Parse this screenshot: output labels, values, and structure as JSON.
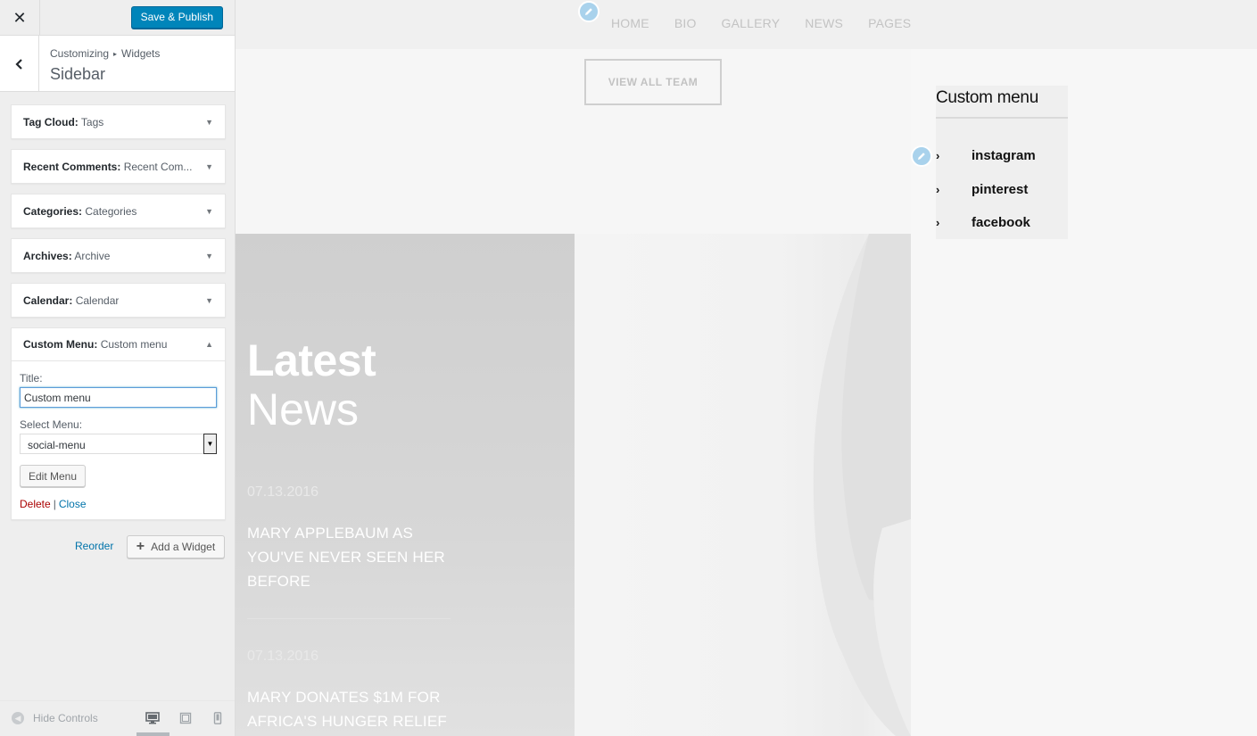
{
  "customizer": {
    "save_label": "Save & Publish",
    "breadcrumb": {
      "parent": "Customizing",
      "child": "Widgets"
    },
    "section_title": "Sidebar",
    "widgets": [
      {
        "type": "Tag Cloud",
        "title": "Tags"
      },
      {
        "type": "Recent Comments",
        "title": "Recent Com..."
      },
      {
        "type": "Categories",
        "title": "Categories"
      },
      {
        "type": "Archives",
        "title": "Archive"
      },
      {
        "type": "Calendar",
        "title": "Calendar"
      },
      {
        "type": "Custom Menu",
        "title": "Custom menu"
      }
    ],
    "custom_menu_form": {
      "title_label": "Title:",
      "title_value": "Custom menu",
      "select_label": "Select Menu:",
      "select_value": "social-menu",
      "edit_menu_label": "Edit Menu",
      "delete_label": "Delete",
      "separator": "|",
      "close_label": "Close"
    },
    "reorder_label": "Reorder",
    "add_widget_label": "Add a Widget",
    "footer": {
      "hide_controls_label": "Hide Controls"
    }
  },
  "preview": {
    "nav": [
      "HOME",
      "BIO",
      "GALLERY",
      "NEWS",
      "PAGES"
    ],
    "view_all_label": "VIEW ALL TEAM",
    "news": {
      "title_line1": "Latest",
      "title_line2": "News",
      "items": [
        {
          "date": "07.13.2016",
          "headline": "MARY APPLEBAUM AS YOU'VE NEVER SEEN HER BEFORE"
        },
        {
          "date": "07.13.2016",
          "headline": "MARY DONATES $1M FOR AFRICA'S HUNGER RELIEF"
        }
      ]
    },
    "custom_menu": {
      "title": "Custom menu",
      "items": [
        "instagram",
        "pinterest",
        "facebook"
      ]
    }
  },
  "colors": {
    "primary_button": "#0085ba",
    "link": "#0073aa",
    "delete": "#aa0000",
    "edit_shortcut": "#a9d2ec"
  }
}
